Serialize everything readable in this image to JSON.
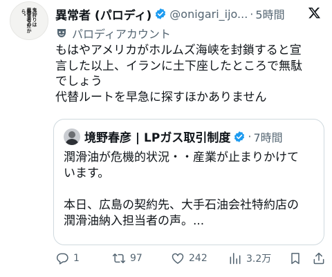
{
  "tweet": {
    "author_name": "異常者 (パロディ)",
    "handle": "@onigari_ijo...",
    "separator": "·",
    "time": "5時間",
    "parody_label": "パロディアカウント",
    "avatar_text": [
      "鬼狩りは",
      "異常者の",
      "集まりだから。"
    ],
    "lines": [
      "もはやアメリカがホルムズ海峡を封鎖すると宣",
      "言した以上、イランに土下座したところで無駄",
      "でしょう",
      "代替ルートを早急に探すほかありません"
    ]
  },
  "quote": {
    "author_name": "境野春彦 | LPガス取引制度",
    "separator": "·",
    "time": "7時間",
    "lines": [
      "潤滑油が危機的状況・・産業が止まりかけて",
      "います。",
      "",
      "本日、広島の契約先、大手石油会社特約店の",
      "潤滑油納入担当者の声。..."
    ]
  },
  "actions": {
    "replies": "1",
    "retweets": "97",
    "likes": "242",
    "views": "3.2万"
  },
  "colors": {
    "text": "#0f1419",
    "muted": "#536471",
    "verified": "#1d9bf0",
    "border": "#cfd9de"
  }
}
